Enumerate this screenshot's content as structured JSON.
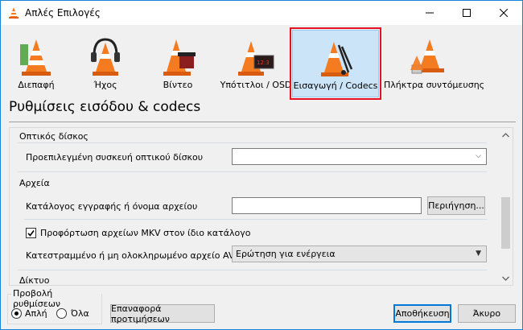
{
  "window": {
    "title": "Απλές Επιλογές"
  },
  "categories": [
    {
      "label": "Διεπαφή",
      "icon": "interface-cone-icon"
    },
    {
      "label": "Ήχος",
      "icon": "audio-headphones-cone-icon"
    },
    {
      "label": "Βίντεο",
      "icon": "video-cone-icon"
    },
    {
      "label": "Υπότιτλοι / OSD",
      "icon": "subtitles-cone-icon"
    },
    {
      "label": "Εισαγωγή / Codecs",
      "icon": "input-codecs-cone-icon",
      "selected": true
    },
    {
      "label": "Πλήκτρα συντόμευσης",
      "icon": "hotkeys-cone-icon"
    }
  ],
  "section_title": "Ρυθμίσεις εισόδου & codecs",
  "groups": {
    "optical": {
      "title": "Οπτικός δίσκος",
      "default_device_label": "Προεπιλεγμένη συσκευή οπτικού δίσκου",
      "default_device_value": ""
    },
    "files": {
      "title": "Αρχεία",
      "record_dir_label": "Κατάλογος εγγραφής ή όνομα αρχείου",
      "record_dir_value": "",
      "browse_button": "Περιήγηση...",
      "preload_mkv_label": "Προφόρτωση αρχείων MKV στον ίδιο κατάλογο",
      "preload_mkv_checked": true,
      "damaged_avi_label": "Κατεστραμμένο ή μη ολοκληρωμένο αρχείο AVI",
      "damaged_avi_value": "Ερώτηση για ενέργεια"
    },
    "network": {
      "title": "Δίκτυο"
    }
  },
  "show_settings": {
    "legend": "Προβολή ρυθμίσεων",
    "simple": "Απλή",
    "all": "Όλα",
    "selected": "simple"
  },
  "buttons": {
    "reset": "Επαναφορά προτιμήσεων",
    "save": "Αποθήκευση",
    "cancel": "Άκυρο"
  },
  "colors": {
    "accent": "#0078d7",
    "highlight": "#e81123",
    "cone_orange": "#f47b20"
  }
}
